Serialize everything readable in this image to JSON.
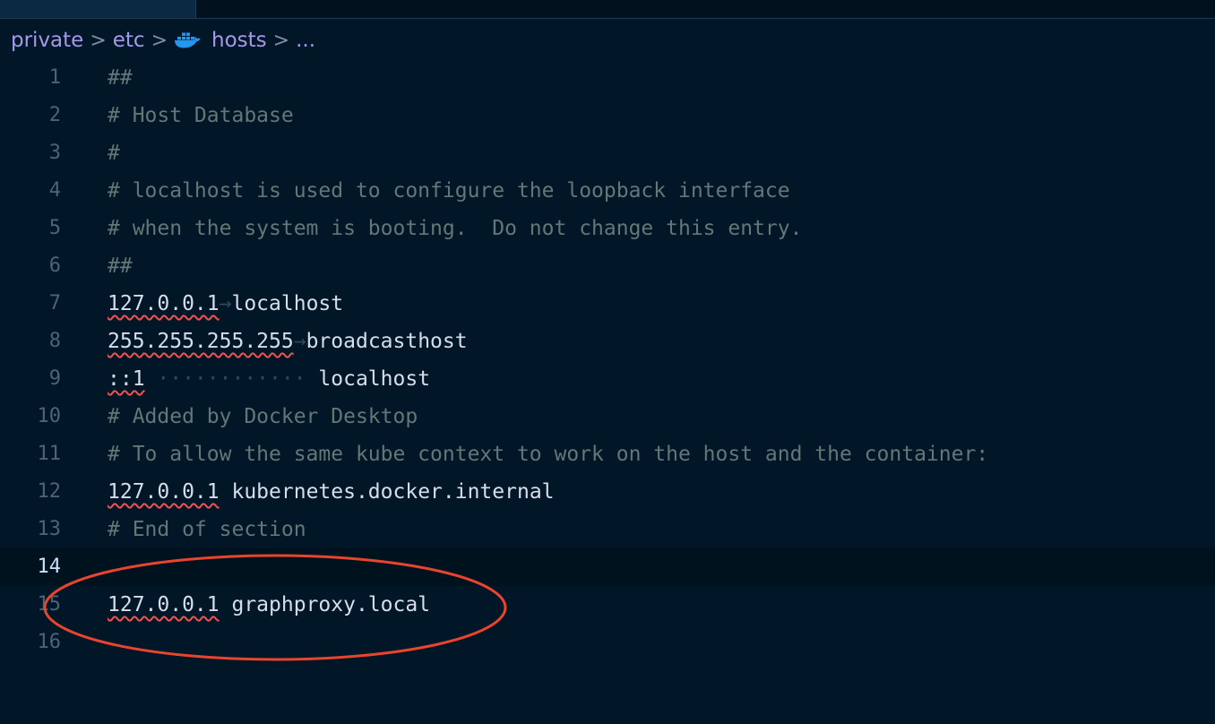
{
  "breadcrumb": {
    "items": [
      "private",
      "etc",
      "hosts",
      "..."
    ],
    "separator": ">",
    "file_icon": "docker-whale-icon",
    "color": "#a599e9"
  },
  "colors": {
    "background": "#011627",
    "comment": "#637777",
    "text": "#d6deeb",
    "squiggle": "#ef5350",
    "annotation_ellipse": "#e8442e"
  },
  "editor": {
    "current_line": 14,
    "lines": [
      {
        "n": "1",
        "comment": "##"
      },
      {
        "n": "2",
        "comment": "# Host Database"
      },
      {
        "n": "3",
        "comment": "#"
      },
      {
        "n": "4",
        "comment": "# localhost is used to configure the loopback interface"
      },
      {
        "n": "5",
        "comment": "# when the system is booting.  Do not change this entry."
      },
      {
        "n": "6",
        "comment": "##"
      },
      {
        "n": "7",
        "ip": "127.0.0.1",
        "sep": "→",
        "host": "localhost"
      },
      {
        "n": "8",
        "ip": "255.255.255.255",
        "sep": "→",
        "host": "broadcasthost"
      },
      {
        "n": "9",
        "ip": "::1",
        "sep": " ············ ",
        "host": "localhost"
      },
      {
        "n": "10",
        "comment": "# Added by Docker Desktop"
      },
      {
        "n": "11",
        "comment": "# To allow the same kube context to work on the host and the container:"
      },
      {
        "n": "12",
        "ip": "127.0.0.1",
        "sep": " ",
        "host": "kubernetes.docker.internal"
      },
      {
        "n": "13",
        "comment": "# End of section"
      },
      {
        "n": "14"
      },
      {
        "n": "15",
        "ip": "127.0.0.1",
        "sep": " ",
        "host": "graphproxy.local"
      },
      {
        "n": "16"
      }
    ]
  }
}
